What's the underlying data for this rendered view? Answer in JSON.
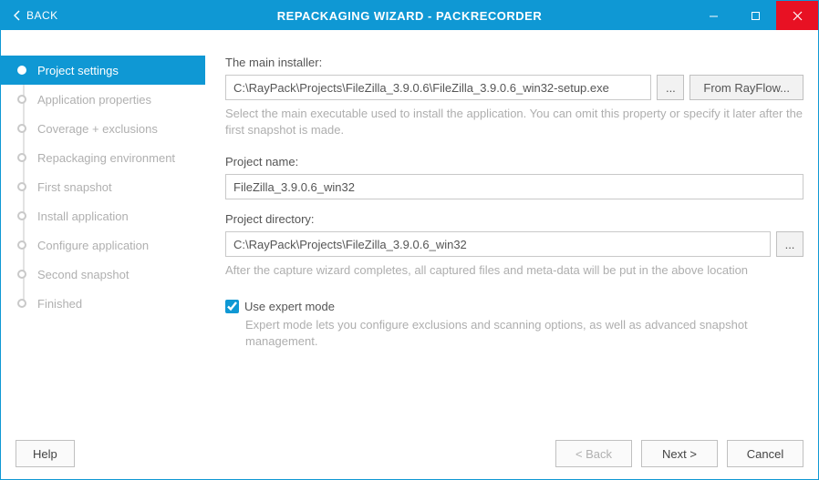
{
  "titlebar": {
    "back": "BACK",
    "title": "REPACKAGING WIZARD - PACKRECORDER"
  },
  "sidebar": {
    "steps": [
      {
        "label": "Project settings",
        "active": true
      },
      {
        "label": "Application properties",
        "active": false
      },
      {
        "label": "Coverage + exclusions",
        "active": false
      },
      {
        "label": "Repackaging environment",
        "active": false
      },
      {
        "label": "First snapshot",
        "active": false
      },
      {
        "label": "Install application",
        "active": false
      },
      {
        "label": "Configure application",
        "active": false
      },
      {
        "label": "Second snapshot",
        "active": false
      },
      {
        "label": "Finished",
        "active": false
      }
    ]
  },
  "main": {
    "installer_label": "The main installer:",
    "installer_value": "C:\\RayPack\\Projects\\FileZilla_3.9.0.6\\FileZilla_3.9.0.6_win32-setup.exe",
    "browse_label": "...",
    "rayflow_label": "From RayFlow...",
    "installer_hint": "Select the main executable used to install the application. You can omit this property or specify it later after the first snapshot is made.",
    "projname_label": "Project name:",
    "projname_value": "FileZilla_3.9.0.6_win32",
    "projdir_label": "Project directory:",
    "projdir_value": "C:\\RayPack\\Projects\\FileZilla_3.9.0.6_win32",
    "projdir_hint": "After the capture wizard completes, all captured files and meta-data will be put in the above location",
    "expert_checked": true,
    "expert_label": "Use expert mode",
    "expert_hint": "Expert mode lets you configure exclusions and scanning options, as well as advanced snapshot management."
  },
  "footer": {
    "help": "Help",
    "back": "< Back",
    "next": "Next >",
    "cancel": "Cancel"
  }
}
